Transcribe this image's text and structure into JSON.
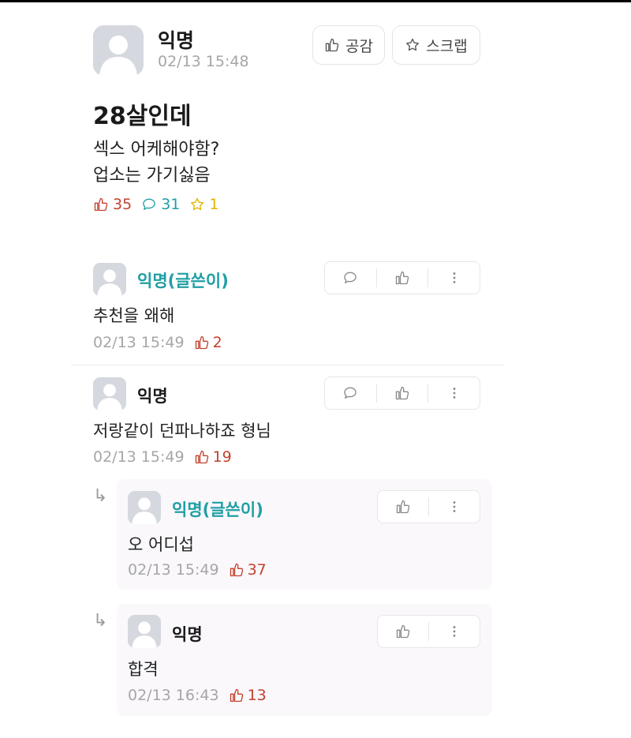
{
  "post": {
    "author": "익명",
    "time": "02/13 15:48",
    "like_button_label": "공감",
    "scrap_button_label": "스크랩",
    "title": "28살인데",
    "body_line1": "섹스 어케해야함?",
    "body_line2": "업소는 가기싫음",
    "likes": "35",
    "comments": "31",
    "scraps": "1"
  },
  "comments": [
    {
      "author": "익명(글쓴이)",
      "text": "추천을 왜해",
      "time": "02/13 15:49",
      "likes": "2"
    },
    {
      "author": "익명",
      "text": "저랑같이 던파나하죠 형님",
      "time": "02/13 15:49",
      "likes": "19"
    }
  ],
  "replies": [
    {
      "author": "익명(글쓴이)",
      "text": "오 어디섭",
      "time": "02/13 15:49",
      "likes": "37"
    },
    {
      "author": "익명",
      "text": "합격",
      "time": "02/13 16:43",
      "likes": "13"
    }
  ],
  "colors": {
    "op_author": "#1f9fa5",
    "like": "#c2412e",
    "comment": "#1f9fa5",
    "scrap": "#e0b400",
    "meta": "#a6a6a6"
  },
  "icons": [
    "thumbs-up-icon",
    "star-icon",
    "speech-bubble-icon",
    "more-vertical-icon",
    "reply-arrow-icon",
    "avatar-placeholder-icon"
  ]
}
